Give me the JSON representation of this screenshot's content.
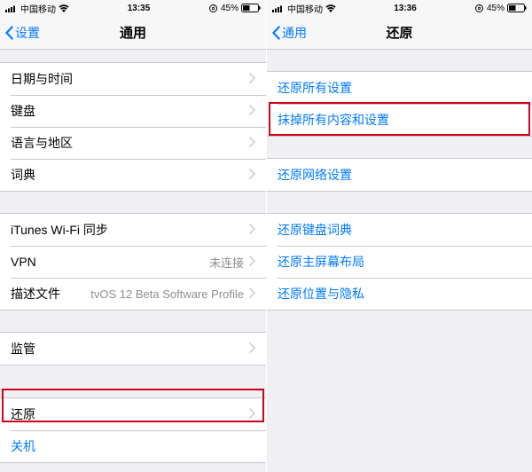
{
  "left": {
    "status": {
      "carrier": "中国移动",
      "time": "13:35",
      "battery": "45%"
    },
    "nav": {
      "back": "设置",
      "title": "通用"
    },
    "rows": {
      "datetime": "日期与时间",
      "keyboard": "键盘",
      "lang": "语言与地区",
      "dict": "词典",
      "itunes": "iTunes Wi-Fi 同步",
      "vpn": "VPN",
      "vpn_value": "未连接",
      "profile": "描述文件",
      "profile_value": "tvOS 12 Beta Software Profile",
      "supervision": "监管",
      "reset": "还原",
      "shutdown": "关机"
    }
  },
  "right": {
    "status": {
      "carrier": "中国移动",
      "time": "13:36",
      "battery": "45%"
    },
    "nav": {
      "back": "通用",
      "title": "还原"
    },
    "rows": {
      "all_settings": "还原所有设置",
      "erase_all": "抹掉所有内容和设置",
      "network": "还原网络设置",
      "keyboard_dict": "还原键盘词典",
      "home_layout": "还原主屏幕布局",
      "location_privacy": "还原位置与隐私"
    }
  }
}
